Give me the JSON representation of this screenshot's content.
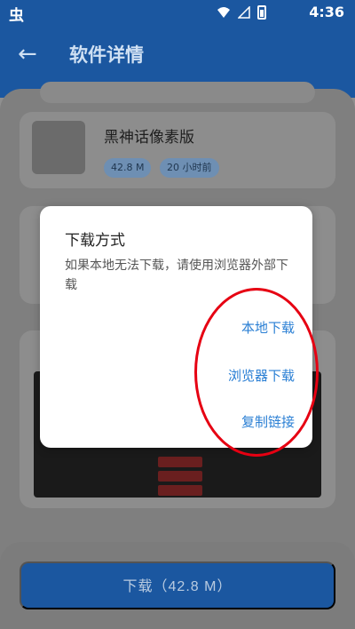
{
  "status_bar": {
    "app_glyph": "虫",
    "time": "4:36"
  },
  "app_bar": {
    "title": "软件详情",
    "back_icon": "arrow-left"
  },
  "app": {
    "name": "黑神话像素版",
    "size": "42.8 M",
    "updated": "20 小时前"
  },
  "dialog": {
    "title": "下载方式",
    "message": "如果本地无法下载，请使用浏览器外部下载",
    "options": [
      "本地下载",
      "浏览器下载",
      "复制链接"
    ]
  },
  "download_button": {
    "label": "下载（42.8 M）"
  },
  "colors": {
    "primary": "#1b57a0",
    "accent_text": "#2a7fd4",
    "highlight": "#e60012"
  }
}
